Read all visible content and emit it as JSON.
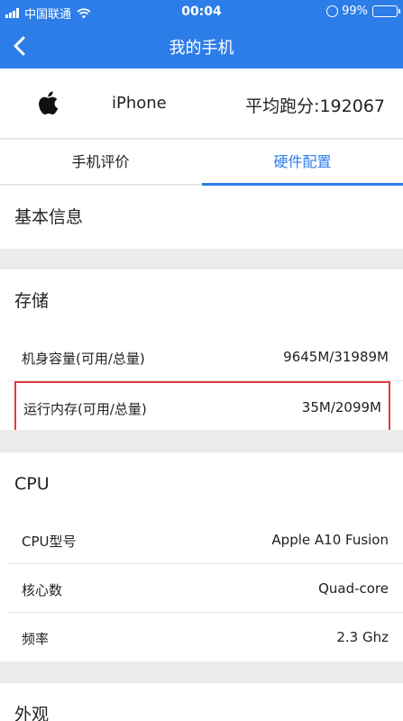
{
  "status_bar": {
    "carrier": "中国联通",
    "time": "00:04",
    "battery_pct": "99%",
    "battery_level": 0.99,
    "accent": "#2d7de8"
  },
  "nav": {
    "title": "我的手机",
    "back_icon": "chevron-left-icon"
  },
  "device": {
    "model": "iPhone",
    "score_label": "平均跑分:192067",
    "logo_icon": "apple-logo-icon"
  },
  "tabs": [
    {
      "label": "手机评价",
      "active": false
    },
    {
      "label": "硬件配置",
      "active": true
    }
  ],
  "sections": {
    "basic": {
      "title": "基本信息"
    },
    "storage": {
      "title": "存储",
      "rows": [
        {
          "key": "机身容量(可用/总量)",
          "value": "9645M/31989M"
        },
        {
          "key": "运行内存(可用/总量)",
          "value": "35M/2099M"
        }
      ]
    },
    "cpu": {
      "title": "CPU",
      "rows": [
        {
          "key": "CPU型号",
          "value": "Apple A10 Fusion"
        },
        {
          "key": "核心数",
          "value": "Quad-core"
        },
        {
          "key": "频率",
          "value": "2.3 Ghz"
        }
      ]
    },
    "appearance": {
      "title": "外观"
    }
  },
  "highlight_color": "#e23b3b"
}
